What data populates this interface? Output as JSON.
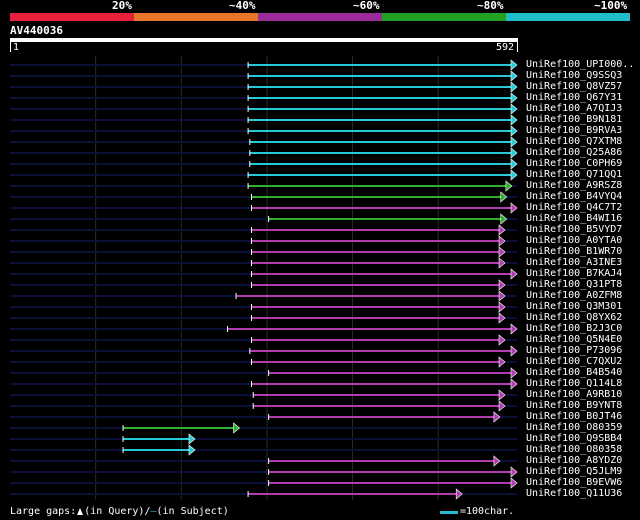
{
  "legend": {
    "segments": [
      {
        "label": "20%",
        "color": "#e8203a"
      },
      {
        "label": "~40%",
        "color": "#e8762a"
      },
      {
        "label": "~60%",
        "color": "#9a2c9a"
      },
      {
        "label": "~80%",
        "color": "#22a022"
      },
      {
        "label": "~100%",
        "color": "#22bcc8"
      }
    ]
  },
  "query": {
    "name": "AV440036",
    "start": "1",
    "end": "592",
    "length": 592
  },
  "colors": {
    "cyan": "#28c8d4",
    "green": "#30b030",
    "purple": "#b03cb0",
    "track": "#0a1038",
    "grid": "#2a2a2a"
  },
  "hits": [
    {
      "label": "UniRef100_UPI000..",
      "start": 278,
      "end": 592,
      "color": "cyan"
    },
    {
      "label": "UniRef100_Q9SSQ3",
      "start": 278,
      "end": 592,
      "color": "cyan"
    },
    {
      "label": "UniRef100_Q8VZ57",
      "start": 278,
      "end": 592,
      "color": "cyan"
    },
    {
      "label": "UniRef100_Q67Y31",
      "start": 278,
      "end": 592,
      "color": "cyan"
    },
    {
      "label": "UniRef100_A7QIJ3",
      "start": 278,
      "end": 592,
      "color": "cyan"
    },
    {
      "label": "UniRef100_B9N181",
      "start": 278,
      "end": 592,
      "color": "cyan"
    },
    {
      "label": "UniRef100_B9RVA3",
      "start": 278,
      "end": 592,
      "color": "cyan"
    },
    {
      "label": "UniRef100_Q7XTM8",
      "start": 280,
      "end": 592,
      "color": "cyan"
    },
    {
      "label": "UniRef100_Q25A86",
      "start": 280,
      "end": 592,
      "color": "cyan"
    },
    {
      "label": "UniRef100_C0PH69",
      "start": 280,
      "end": 592,
      "color": "cyan"
    },
    {
      "label": "UniRef100_Q71QQ1",
      "start": 278,
      "end": 592,
      "color": "cyan"
    },
    {
      "label": "UniRef100_A9RSZ8",
      "start": 278,
      "end": 586,
      "color": "green"
    },
    {
      "label": "UniRef100_B4VYQ4",
      "start": 282,
      "end": 580,
      "color": "green"
    },
    {
      "label": "UniRef100_Q4C7T2",
      "start": 282,
      "end": 592,
      "color": "purple"
    },
    {
      "label": "UniRef100_B4WI16",
      "start": 302,
      "end": 580,
      "color": "green"
    },
    {
      "label": "UniRef100_B5VYD7",
      "start": 282,
      "end": 578,
      "color": "purple"
    },
    {
      "label": "UniRef100_A0YTA0",
      "start": 282,
      "end": 578,
      "color": "purple"
    },
    {
      "label": "UniRef100_B1WR70",
      "start": 282,
      "end": 578,
      "color": "purple"
    },
    {
      "label": "UniRef100_A3INE3",
      "start": 282,
      "end": 578,
      "color": "purple"
    },
    {
      "label": "UniRef100_B7KAJ4",
      "start": 282,
      "end": 592,
      "color": "purple"
    },
    {
      "label": "UniRef100_Q31PT8",
      "start": 282,
      "end": 578,
      "color": "purple"
    },
    {
      "label": "UniRef100_A0ZFM8",
      "start": 264,
      "end": 578,
      "color": "purple"
    },
    {
      "label": "UniRef100_Q3M301",
      "start": 282,
      "end": 578,
      "color": "purple"
    },
    {
      "label": "UniRef100_Q8YX62",
      "start": 282,
      "end": 578,
      "color": "purple"
    },
    {
      "label": "UniRef100_B2J3C0",
      "start": 254,
      "end": 592,
      "color": "purple"
    },
    {
      "label": "UniRef100_Q5N4E0",
      "start": 282,
      "end": 578,
      "color": "purple"
    },
    {
      "label": "UniRef100_P73096",
      "start": 280,
      "end": 592,
      "color": "purple"
    },
    {
      "label": "UniRef100_C7QXU2",
      "start": 282,
      "end": 578,
      "color": "purple"
    },
    {
      "label": "UniRef100_B4B540",
      "start": 302,
      "end": 592,
      "color": "purple"
    },
    {
      "label": "UniRef100_Q114L8",
      "start": 282,
      "end": 592,
      "color": "purple"
    },
    {
      "label": "UniRef100_A9RB10",
      "start": 284,
      "end": 578,
      "color": "purple"
    },
    {
      "label": "UniRef100_B9YNT8",
      "start": 284,
      "end": 578,
      "color": "purple"
    },
    {
      "label": "UniRef100_B0JT46",
      "start": 302,
      "end": 572,
      "color": "purple"
    },
    {
      "label": "UniRef100_O80359",
      "start": 132,
      "end": 268,
      "color": "green"
    },
    {
      "label": "UniRef100_Q9SBB4",
      "start": 132,
      "end": 216,
      "color": "cyan"
    },
    {
      "label": "UniRef100_O80358",
      "start": 132,
      "end": 216,
      "color": "cyan"
    },
    {
      "label": "UniRef100_A8YDZ0",
      "start": 302,
      "end": 572,
      "color": "purple"
    },
    {
      "label": "UniRef100_Q5JLM9",
      "start": 302,
      "end": 592,
      "color": "purple"
    },
    {
      "label": "UniRef100_B9EVW6",
      "start": 302,
      "end": 592,
      "color": "purple"
    },
    {
      "label": "UniRef100_Q11U36",
      "start": 278,
      "end": 528,
      "color": "purple"
    }
  ],
  "footer": {
    "gaps_prefix": "Large gaps:",
    "gaps_query": "(in Query)",
    "gaps_sep": "/",
    "gaps_dash": "–",
    "gaps_subject": "(in Subject)",
    "scale_label": "=100char."
  }
}
